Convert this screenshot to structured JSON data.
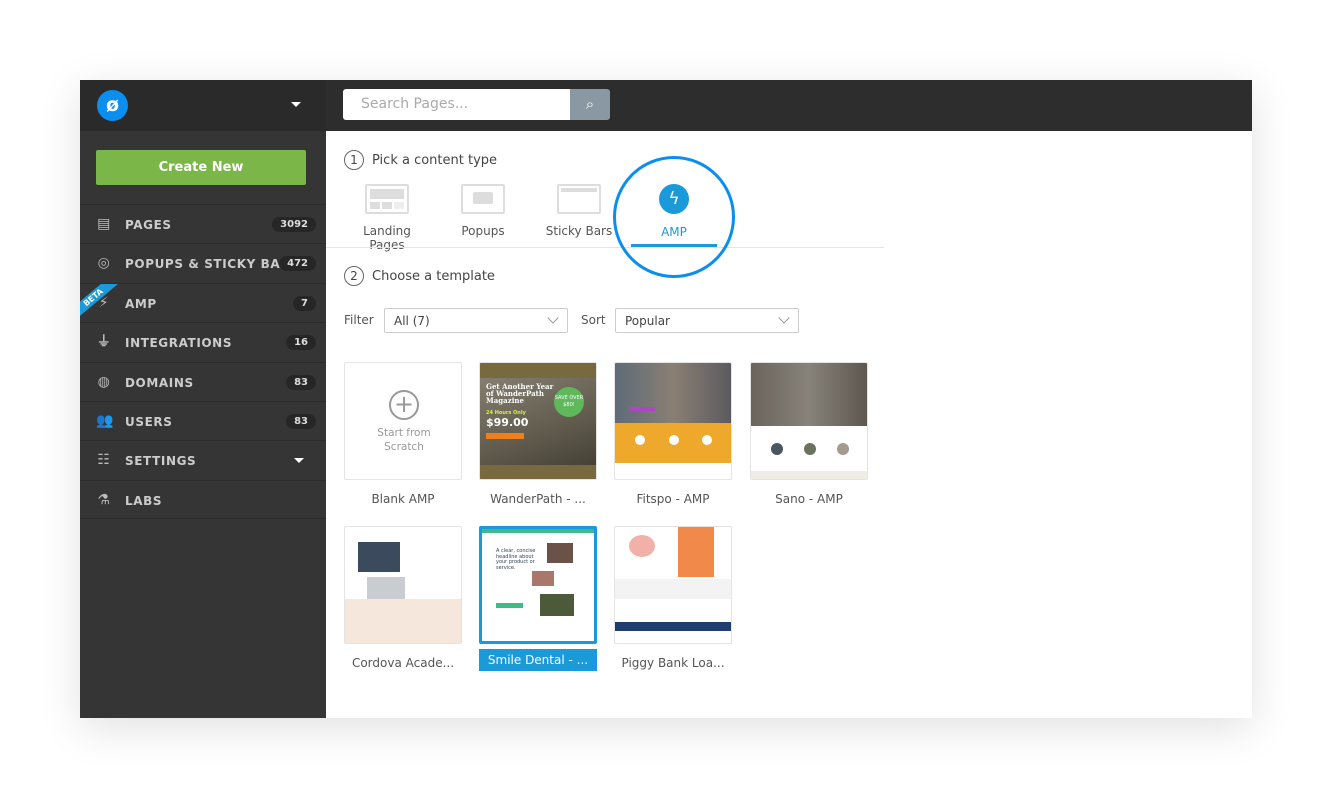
{
  "app": {
    "logo_glyph": "ø",
    "brand_color": "#0a8ff0",
    "accent_green": "#7ab648"
  },
  "sidebar": {
    "create_label": "Create New",
    "items": [
      {
        "label": "PAGES",
        "count": "3092",
        "icon": "pages-icon"
      },
      {
        "label": "POPUPS & STICKY BARS",
        "count": "472",
        "icon": "target-icon"
      },
      {
        "label": "AMP",
        "count": "7",
        "icon": "bolt-icon",
        "badge": "BETA"
      },
      {
        "label": "INTEGRATIONS",
        "count": "16",
        "icon": "plug-icon"
      },
      {
        "label": "DOMAINS",
        "count": "83",
        "icon": "globe-icon"
      },
      {
        "label": "USERS",
        "count": "83",
        "icon": "users-icon"
      },
      {
        "label": "SETTINGS",
        "icon": "sliders-icon"
      },
      {
        "label": "LABS",
        "icon": "flask-icon"
      }
    ]
  },
  "search": {
    "placeholder": "Search Pages..."
  },
  "step1": {
    "num": "1",
    "title": "Pick a content type",
    "types": [
      "Landing Pages",
      "Popups",
      "Sticky Bars",
      "AMP"
    ],
    "selected": "AMP"
  },
  "step2": {
    "num": "2",
    "title": "Choose a template"
  },
  "filter": {
    "label": "Filter",
    "value": "All (7)"
  },
  "sort": {
    "label": "Sort",
    "value": "Popular"
  },
  "templates": [
    {
      "name": "Blank AMP",
      "thumb_text": "Start from Scratch"
    },
    {
      "name": "WanderPath - ...",
      "headline": "Get Another Year of WanderPath Magazine",
      "price": "$99.00",
      "promo": "24 Hours Only",
      "badge": "SAVE OVER $80!"
    },
    {
      "name": "Fitspo - AMP"
    },
    {
      "name": "Sano - AMP"
    },
    {
      "name": "Cordova Acade..."
    },
    {
      "name": "Smile Dental - ...",
      "headline": "A clear, concise headline about your product or service.",
      "selected": true
    },
    {
      "name": "Piggy Bank Loa..."
    }
  ]
}
